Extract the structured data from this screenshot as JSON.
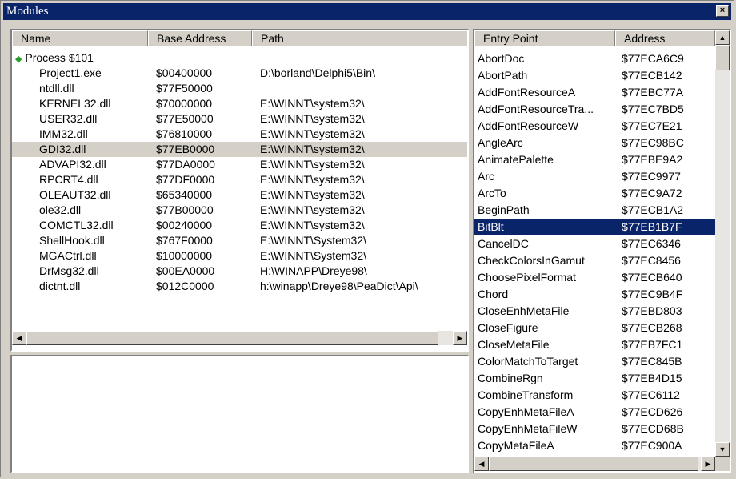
{
  "window": {
    "title": "Modules",
    "close_glyph": "×"
  },
  "modules": {
    "columns": [
      "Name",
      "Base Address",
      "Path"
    ],
    "process_label": "Process $101",
    "rows": [
      {
        "name": "Project1.exe",
        "base": "$00400000",
        "path": "D:\\borland\\Delphi5\\Bin\\"
      },
      {
        "name": "ntdll.dll",
        "base": "$77F50000",
        "path": ""
      },
      {
        "name": "KERNEL32.dll",
        "base": "$70000000",
        "path": "E:\\WINNT\\system32\\"
      },
      {
        "name": "USER32.dll",
        "base": "$77E50000",
        "path": "E:\\WINNT\\system32\\"
      },
      {
        "name": "IMM32.dll",
        "base": "$76810000",
        "path": "E:\\WINNT\\system32\\"
      },
      {
        "name": "GDI32.dll",
        "base": "$77EB0000",
        "path": "E:\\WINNT\\system32\\"
      },
      {
        "name": "ADVAPI32.dll",
        "base": "$77DA0000",
        "path": "E:\\WINNT\\system32\\"
      },
      {
        "name": "RPCRT4.dll",
        "base": "$77DF0000",
        "path": "E:\\WINNT\\system32\\"
      },
      {
        "name": "OLEAUT32.dll",
        "base": "$65340000",
        "path": "E:\\WINNT\\system32\\"
      },
      {
        "name": "ole32.dll",
        "base": "$77B00000",
        "path": "E:\\WINNT\\system32\\"
      },
      {
        "name": "COMCTL32.dll",
        "base": "$00240000",
        "path": "E:\\WINNT\\system32\\"
      },
      {
        "name": "ShellHook.dll",
        "base": "$767F0000",
        "path": "E:\\WINNT\\System32\\"
      },
      {
        "name": "MGACtrl.dll",
        "base": "$10000000",
        "path": "E:\\WINNT\\System32\\"
      },
      {
        "name": "DrMsg32.dll",
        "base": "$00EA0000",
        "path": "H:\\WINAPP\\Dreye98\\"
      },
      {
        "name": "dictnt.dll",
        "base": "$012C0000",
        "path": "h:\\winapp\\Dreye98\\PeaDict\\Api\\"
      }
    ],
    "selected_name": "GDI32.dll"
  },
  "entries": {
    "columns": [
      "Entry Point",
      "Address"
    ],
    "rows": [
      {
        "entry": "AbortDoc",
        "address": "$77ECA6C9"
      },
      {
        "entry": "AbortPath",
        "address": "$77ECB142"
      },
      {
        "entry": "AddFontResourceA",
        "address": "$77EBC77A"
      },
      {
        "entry": "AddFontResourceTra...",
        "address": "$77EC7BD5"
      },
      {
        "entry": "AddFontResourceW",
        "address": "$77EC7E21"
      },
      {
        "entry": "AngleArc",
        "address": "$77EC98BC"
      },
      {
        "entry": "AnimatePalette",
        "address": "$77EBE9A2"
      },
      {
        "entry": "Arc",
        "address": "$77EC9977"
      },
      {
        "entry": "ArcTo",
        "address": "$77EC9A72"
      },
      {
        "entry": "BeginPath",
        "address": "$77ECB1A2"
      },
      {
        "entry": "BitBlt",
        "address": "$77EB1B7F"
      },
      {
        "entry": "CancelDC",
        "address": "$77EC6346"
      },
      {
        "entry": "CheckColorsInGamut",
        "address": "$77EC8456"
      },
      {
        "entry": "ChoosePixelFormat",
        "address": "$77ECB640"
      },
      {
        "entry": "Chord",
        "address": "$77EC9B4F"
      },
      {
        "entry": "CloseEnhMetaFile",
        "address": "$77EBD803"
      },
      {
        "entry": "CloseFigure",
        "address": "$77ECB268"
      },
      {
        "entry": "CloseMetaFile",
        "address": "$77EB7FC1"
      },
      {
        "entry": "ColorMatchToTarget",
        "address": "$77EC845B"
      },
      {
        "entry": "CombineRgn",
        "address": "$77EB4D15"
      },
      {
        "entry": "CombineTransform",
        "address": "$77EC6112"
      },
      {
        "entry": "CopyEnhMetaFileA",
        "address": "$77ECD626"
      },
      {
        "entry": "CopyEnhMetaFileW",
        "address": "$77ECD68B"
      },
      {
        "entry": "CopyMetaFileA",
        "address": "$77EC900A"
      }
    ],
    "selected_entry": "BitBlt"
  },
  "scroll": {
    "left": "◀",
    "right": "▶",
    "up": "▲",
    "down": "▼"
  },
  "colors": {
    "selection": "#0a246a",
    "module_selected": "#d4d0c8"
  }
}
